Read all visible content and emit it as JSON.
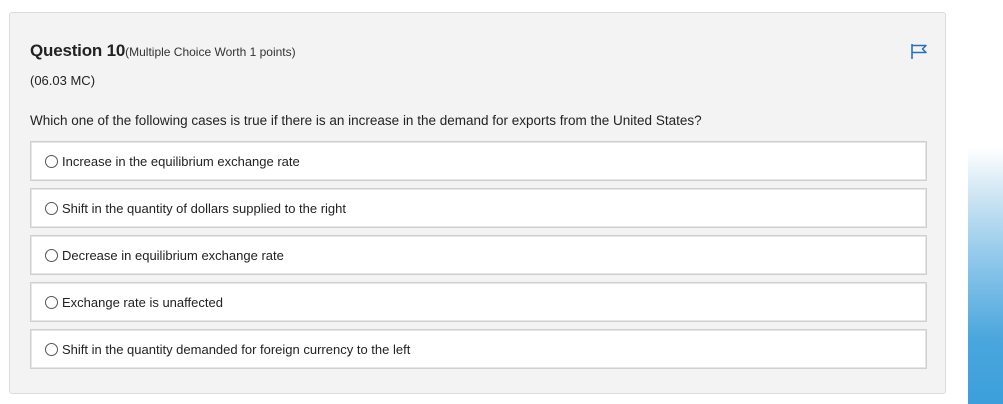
{
  "question": {
    "title": "Question 10",
    "worth": "(Multiple Choice Worth 1 points)",
    "code": "(06.03 MC)",
    "prompt": "Which one of the following cases is true if there is an increase in the demand for exports from the United States?",
    "flag_icon": "flag-icon",
    "accent_color": "#2a6fb8"
  },
  "options": [
    {
      "label": "Increase in the equilibrium exchange rate",
      "selected": false
    },
    {
      "label": "Shift in the quantity of dollars supplied to the right",
      "selected": false
    },
    {
      "label": "Decrease in equilibrium exchange rate",
      "selected": false
    },
    {
      "label": "Exchange rate is unaffected",
      "selected": false
    },
    {
      "label": "Shift in the quantity demanded for foreign currency to the left",
      "selected": false
    }
  ]
}
